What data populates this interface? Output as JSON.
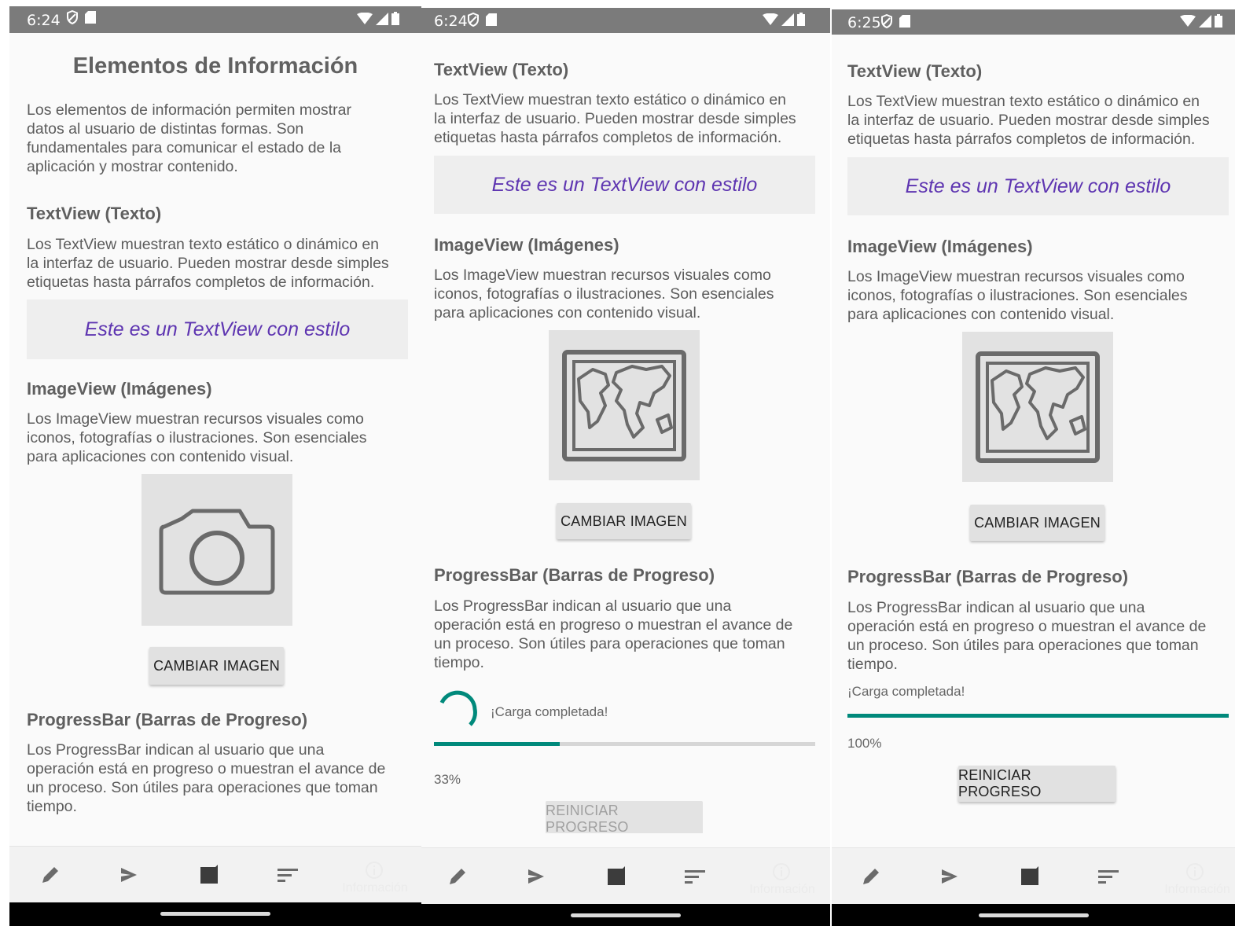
{
  "colors": {
    "accent": "#00897b",
    "styled_text": "#5e35b1",
    "status_bar": "#7b7b7b"
  },
  "screens": [
    {
      "status": {
        "time": "6:24"
      },
      "title": "Elementos de Información",
      "intro": [
        "Los elementos de información permiten mostrar",
        "datos al usuario de distintas formas. Son",
        "fundamentales para comunicar el estado de la",
        "aplicación y mostrar contenido."
      ],
      "textview_heading": "TextView (Texto)",
      "textview_desc": [
        "Los TextView muestran texto estático o dinámico en",
        "la interfaz de usuario. Pueden mostrar desde simples",
        "etiquetas hasta párrafos completos de información."
      ],
      "styled_text": "Este es un TextView con estilo",
      "imageview_heading": "ImageView (Imágenes)",
      "imageview_desc": [
        "Los ImageView muestran recursos visuales como",
        "iconos, fotografías o ilustraciones. Son esenciales",
        "para aplicaciones con contenido visual."
      ],
      "image_icon": "camera-icon",
      "change_image_button": "CAMBIAR IMAGEN",
      "progress_heading": "ProgressBar (Barras de Progreso)",
      "progress_desc": [
        "Los ProgressBar indican al usuario que una",
        "operación está en progreso o muestran el avance de",
        "un proceso. Son útiles para operaciones que toman",
        "tiempo."
      ],
      "bottom_nav": [
        "edit-icon",
        "send-icon",
        "note-icon",
        "sort-icon",
        "info-icon"
      ],
      "bottom_nav_label": "Información"
    },
    {
      "status": {
        "time": "6:24"
      },
      "textview_heading": "TextView (Texto)",
      "textview_desc": [
        "Los TextView muestran texto estático o dinámico en",
        "la interfaz de usuario. Pueden mostrar desde simples",
        "etiquetas hasta párrafos completos de información."
      ],
      "styled_text": "Este es un TextView con estilo",
      "imageview_heading": "ImageView (Imágenes)",
      "imageview_desc": [
        "Los ImageView muestran recursos visuales como",
        "iconos, fotografías o ilustraciones. Son esenciales",
        "para aplicaciones con contenido visual."
      ],
      "image_icon": "map-icon",
      "change_image_button": "CAMBIAR IMAGEN",
      "progress_heading": "ProgressBar (Barras de Progreso)",
      "progress_desc": [
        "Los ProgressBar indican al usuario que una",
        "operación está en progreso o muestran el avance de",
        "un proceso. Son útiles para operaciones que toman",
        "tiempo."
      ],
      "loading_text": "¡Carga completada!",
      "progress_value": 0.33,
      "progress_label": "33%",
      "reset_button": "REINICIAR PROGRESO",
      "reset_enabled": false,
      "bottom_nav_label": "Información"
    },
    {
      "status": {
        "time": "6:25"
      },
      "textview_heading": "TextView (Texto)",
      "textview_desc": [
        "Los TextView muestran texto estático o dinámico en",
        "la interfaz de usuario. Pueden mostrar desde simples",
        "etiquetas hasta párrafos completos de información."
      ],
      "styled_text": "Este es un TextView con estilo",
      "imageview_heading": "ImageView (Imágenes)",
      "imageview_desc": [
        "Los ImageView muestran recursos visuales como",
        "iconos, fotografías o ilustraciones. Son esenciales",
        "para aplicaciones con contenido visual."
      ],
      "image_icon": "map-icon",
      "change_image_button": "CAMBIAR IMAGEN",
      "progress_heading": "ProgressBar (Barras de Progreso)",
      "progress_desc": [
        "Los ProgressBar indican al usuario que una",
        "operación está en progreso o muestran el avance de",
        "un proceso. Son útiles para operaciones que toman",
        "tiempo."
      ],
      "loading_text": "¡Carga completada!",
      "progress_value": 1.0,
      "progress_label": "100%",
      "reset_button": "REINICIAR PROGRESO",
      "reset_enabled": true,
      "bottom_nav_label": "Información"
    }
  ]
}
